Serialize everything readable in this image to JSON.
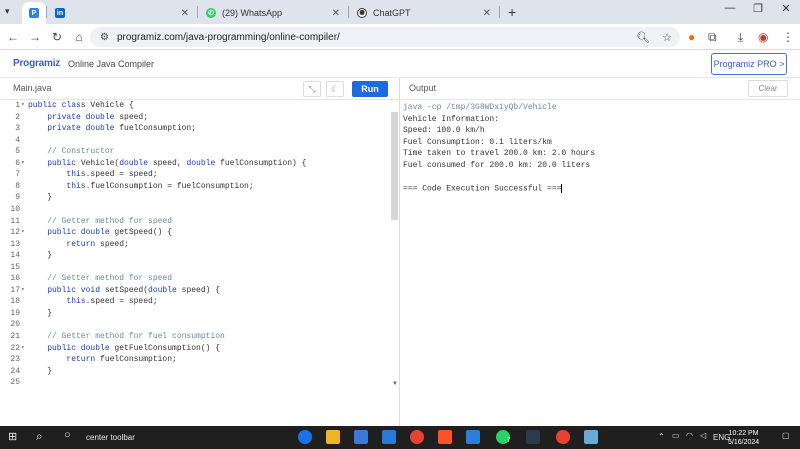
{
  "browser": {
    "tabs": [
      {
        "label": "",
        "favicon": "programiz-icon",
        "active": true
      },
      {
        "label": "",
        "favicon": "linkedin-icon",
        "active": false
      },
      {
        "label": "(29) WhatsApp",
        "favicon": "whatsapp-icon",
        "active": false
      },
      {
        "label": "ChatGPT",
        "favicon": "chatgpt-icon",
        "active": false
      }
    ],
    "new_tab": "+",
    "url": "programiz.com/java-programming/online-compiler/"
  },
  "header": {
    "logo": "Programiz",
    "product": "Online Java Compiler",
    "pro_button": "Programiz PRO >"
  },
  "editor": {
    "file_tab": "Main.java",
    "run_label": "Run",
    "lines": [
      {
        "n": "1",
        "fold": true,
        "segs": [
          [
            "kw",
            "public class "
          ],
          [
            "",
            "Vehicle {"
          ]
        ]
      },
      {
        "n": "2",
        "fold": false,
        "segs": [
          [
            "",
            "    "
          ],
          [
            "kw",
            "private double "
          ],
          [
            "",
            "speed;"
          ]
        ]
      },
      {
        "n": "3",
        "fold": false,
        "segs": [
          [
            "",
            "    "
          ],
          [
            "kw",
            "private double "
          ],
          [
            "",
            "fuelConsumption;"
          ]
        ]
      },
      {
        "n": "4",
        "fold": false,
        "segs": []
      },
      {
        "n": "5",
        "fold": false,
        "segs": [
          [
            "",
            "    "
          ],
          [
            "cm",
            "// Constructor"
          ]
        ]
      },
      {
        "n": "6",
        "fold": true,
        "segs": [
          [
            "",
            "    "
          ],
          [
            "kw",
            "public "
          ],
          [
            "",
            "Vehicle("
          ],
          [
            "kw",
            "double "
          ],
          [
            "",
            "speed, "
          ],
          [
            "kw",
            "double "
          ],
          [
            "",
            "fuelConsumption) {"
          ]
        ]
      },
      {
        "n": "7",
        "fold": false,
        "segs": [
          [
            "",
            "        "
          ],
          [
            "kw",
            "this"
          ],
          [
            "",
            ".speed = speed;"
          ]
        ]
      },
      {
        "n": "8",
        "fold": false,
        "segs": [
          [
            "",
            "        "
          ],
          [
            "kw",
            "this"
          ],
          [
            "",
            ".fuelConsumption = fuelConsumption;"
          ]
        ]
      },
      {
        "n": "9",
        "fold": false,
        "segs": [
          [
            "",
            "    }"
          ]
        ]
      },
      {
        "n": "10",
        "fold": false,
        "segs": []
      },
      {
        "n": "11",
        "fold": false,
        "segs": [
          [
            "",
            "    "
          ],
          [
            "cm",
            "// Getter method for speed"
          ]
        ]
      },
      {
        "n": "12",
        "fold": true,
        "segs": [
          [
            "",
            "    "
          ],
          [
            "kw",
            "public double "
          ],
          [
            "",
            "getSpeed() {"
          ]
        ]
      },
      {
        "n": "13",
        "fold": false,
        "segs": [
          [
            "",
            "        "
          ],
          [
            "kw",
            "return "
          ],
          [
            "",
            "speed;"
          ]
        ]
      },
      {
        "n": "14",
        "fold": false,
        "segs": [
          [
            "",
            "    }"
          ]
        ]
      },
      {
        "n": "15",
        "fold": false,
        "segs": []
      },
      {
        "n": "16",
        "fold": false,
        "segs": [
          [
            "",
            "    "
          ],
          [
            "cm",
            "// Setter method for speed"
          ]
        ]
      },
      {
        "n": "17",
        "fold": true,
        "segs": [
          [
            "",
            "    "
          ],
          [
            "kw",
            "public void "
          ],
          [
            "",
            "setSpeed("
          ],
          [
            "kw",
            "double "
          ],
          [
            "",
            "speed) {"
          ]
        ]
      },
      {
        "n": "18",
        "fold": false,
        "segs": [
          [
            "",
            "        "
          ],
          [
            "kw",
            "this"
          ],
          [
            "",
            ".speed = speed;"
          ]
        ]
      },
      {
        "n": "19",
        "fold": false,
        "segs": [
          [
            "",
            "    }"
          ]
        ]
      },
      {
        "n": "20",
        "fold": false,
        "segs": []
      },
      {
        "n": "21",
        "fold": false,
        "segs": [
          [
            "",
            "    "
          ],
          [
            "cm",
            "// Getter method for fuel consumption"
          ]
        ]
      },
      {
        "n": "22",
        "fold": true,
        "segs": [
          [
            "",
            "    "
          ],
          [
            "kw",
            "public double "
          ],
          [
            "",
            "getFuelConsumption() {"
          ]
        ]
      },
      {
        "n": "23",
        "fold": false,
        "segs": [
          [
            "",
            "        "
          ],
          [
            "kw",
            "return "
          ],
          [
            "",
            "fuelConsumption;"
          ]
        ]
      },
      {
        "n": "24",
        "fold": false,
        "segs": [
          [
            "",
            "    }"
          ]
        ]
      },
      {
        "n": "25",
        "fold": false,
        "segs": []
      }
    ]
  },
  "output": {
    "label": "Output",
    "clear_label": "Clear",
    "command": "java -cp /tmp/3G8WDx1yQb/Vehicle",
    "lines": [
      "Vehicle Information:",
      "Speed: 100.0 km/h",
      "Fuel Consumption: 0.1 liters/km",
      "Time taken to travel 200.0 km: 2.0 hours",
      "Fuel consumed for 200.0 km: 20.0 liters",
      "",
      "=== Code Execution Successful ==="
    ]
  },
  "taskbar": {
    "search_text": "center toolbar",
    "lang": "ENG",
    "time": "10:22 PM",
    "date": "5/16/2024",
    "badge": "7"
  },
  "colors": {
    "accent": "#1e6be0",
    "keyword": "#1b39c9",
    "comment": "#6a8a9a"
  }
}
